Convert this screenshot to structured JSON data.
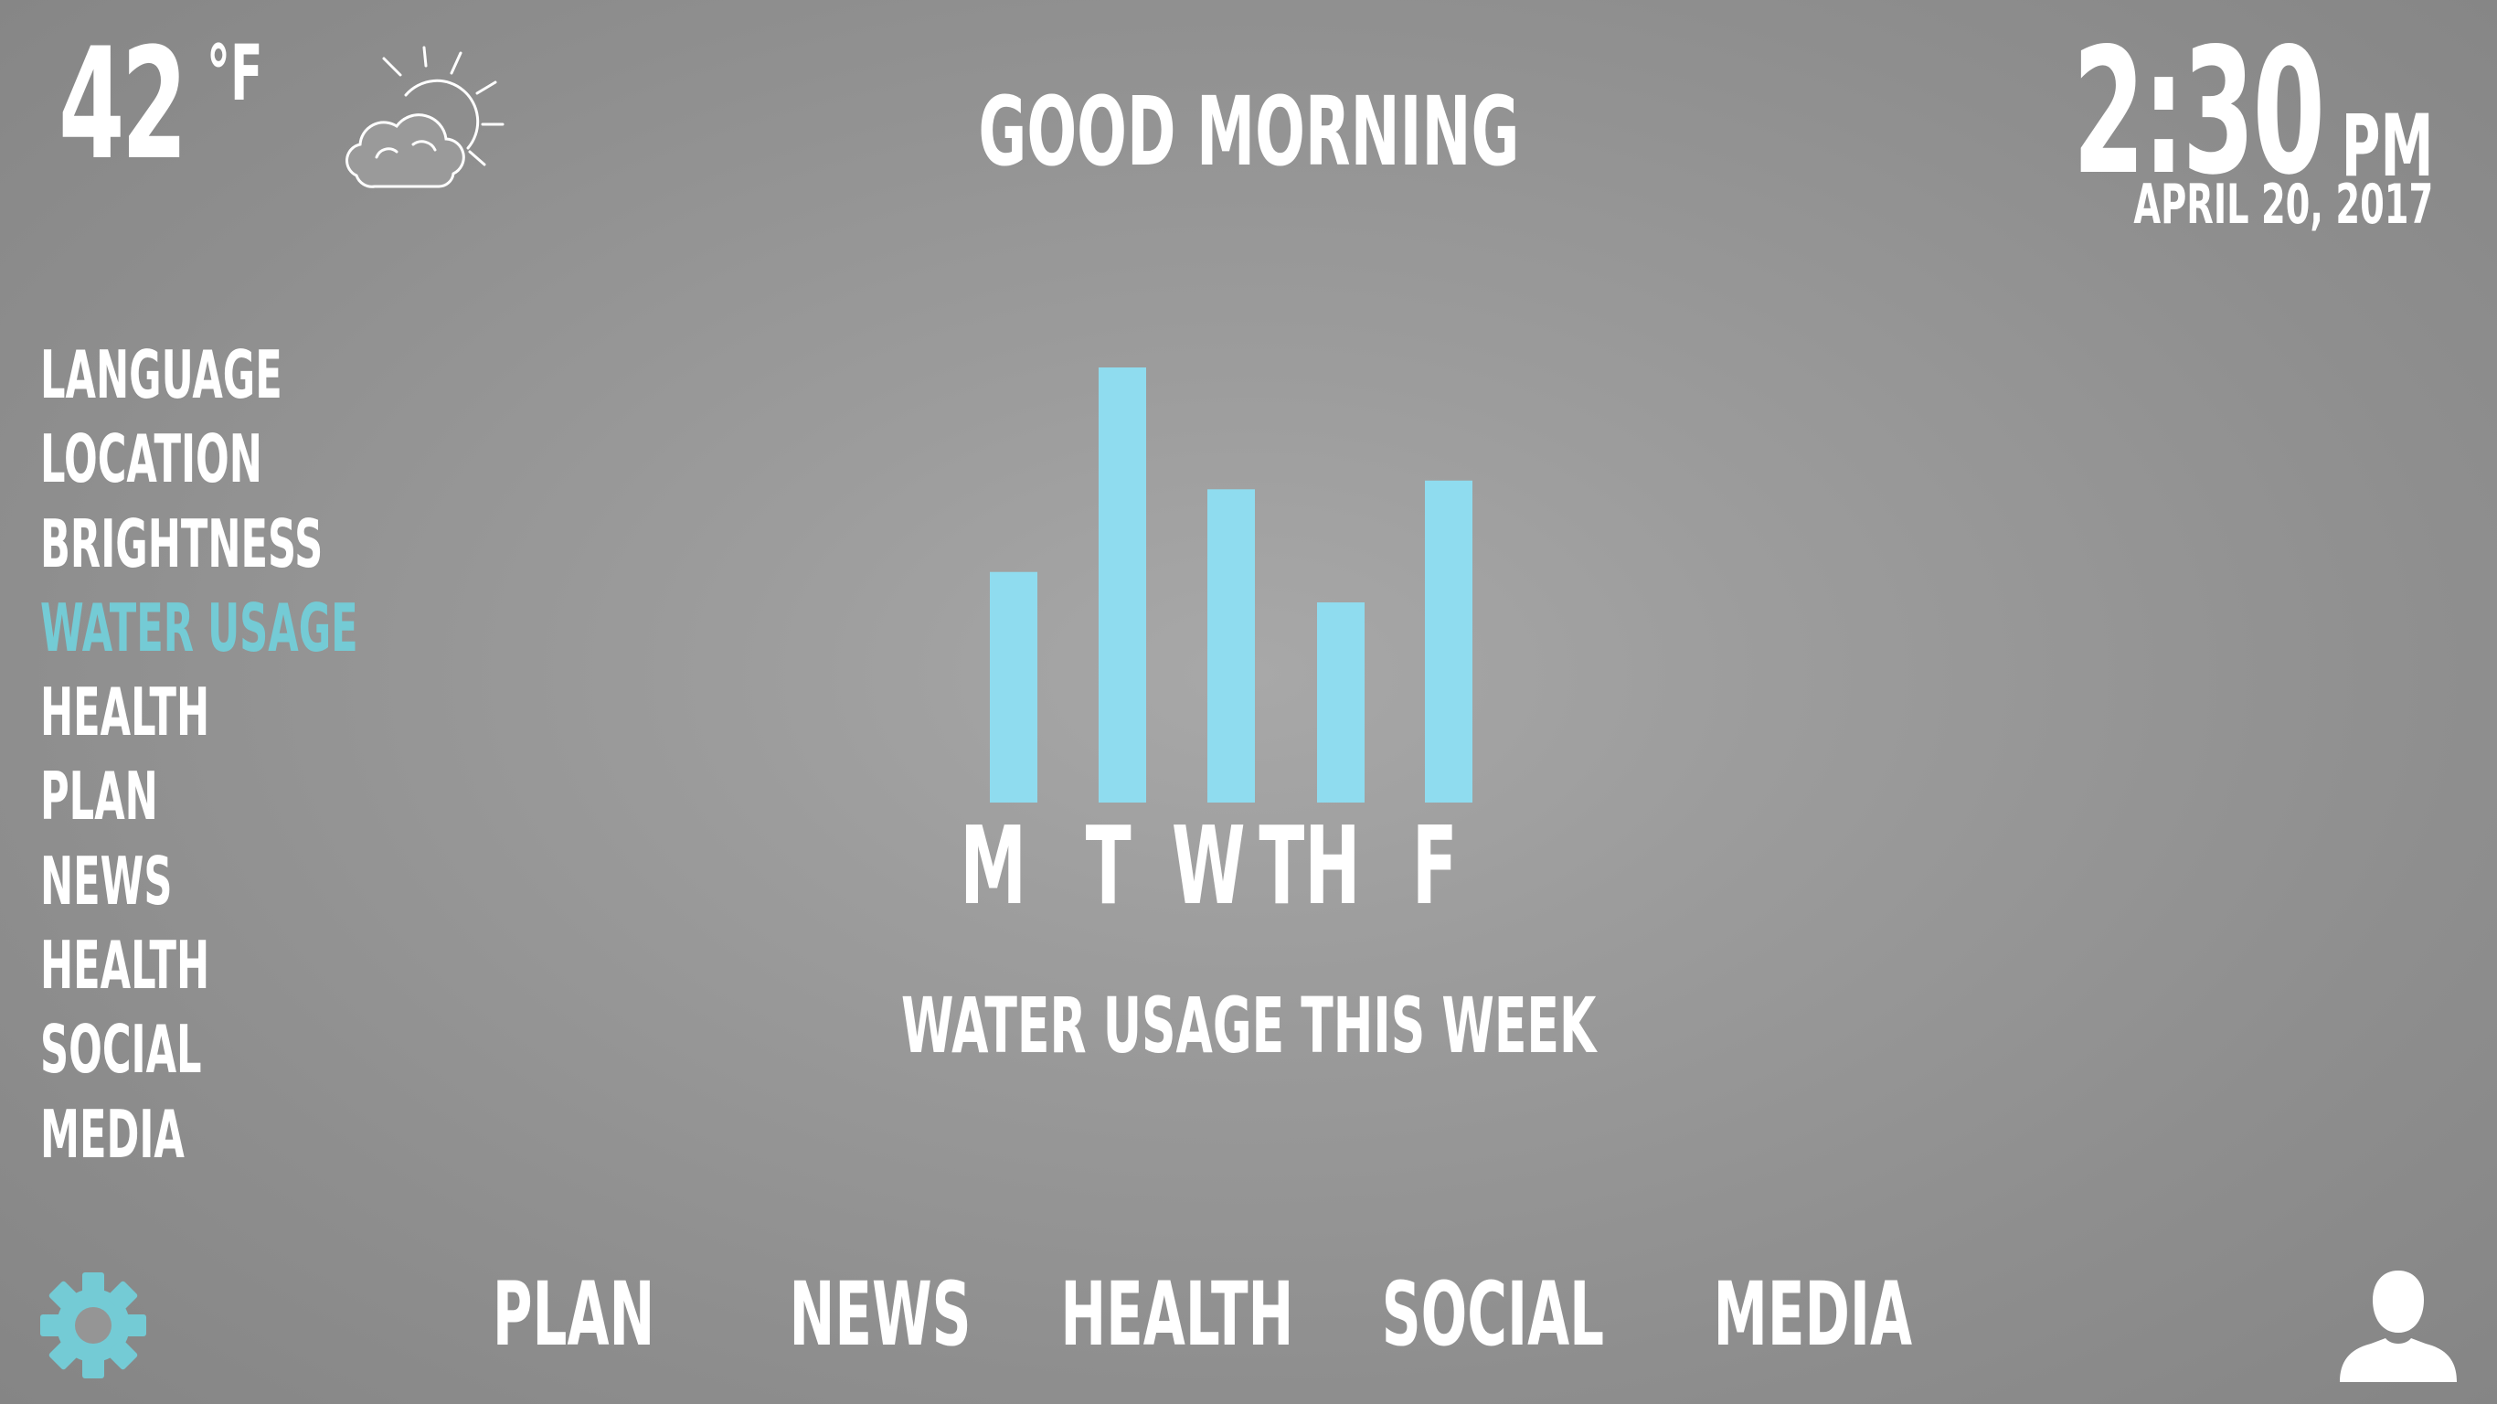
{
  "weather": {
    "temperature": "42",
    "unit": "°F",
    "condition_icon": "partly-sunny-cloud-icon"
  },
  "greeting": "GOOD MORNING",
  "clock": {
    "time": "2:30",
    "ampm": "PM",
    "date": "APRIL 20, 2017"
  },
  "sidebar": {
    "items": [
      {
        "label": "LANGUAGE"
      },
      {
        "label": "LOCATION"
      },
      {
        "label": "BRIGHTNESS"
      },
      {
        "label": "WATER USAGE",
        "active": true
      },
      {
        "label": "HEALTH"
      },
      {
        "label": "PLAN"
      },
      {
        "label": "NEWS"
      },
      {
        "label": "HEALTH"
      },
      {
        "label": "SOCIAL"
      },
      {
        "label": "MEDIA"
      }
    ]
  },
  "chart_data": {
    "type": "bar",
    "categories": [
      "M",
      "T",
      "W",
      "TH",
      "F"
    ],
    "values": [
      0.53,
      1.0,
      0.72,
      0.46,
      0.74
    ],
    "title": "WATER USAGE THIS WEEK",
    "ylim": [
      0,
      1
    ],
    "grid": false,
    "bar_color": "#8fdcef"
  },
  "bottom_nav": {
    "items": [
      {
        "label": "PLAN"
      },
      {
        "label": "NEWS"
      },
      {
        "label": "HEALTH"
      },
      {
        "label": "SOCIAL"
      },
      {
        "label": "MEDIA"
      }
    ]
  },
  "colors": {
    "accent": "#74cbd5",
    "text": "#ffffff",
    "bar": "#8fdcef"
  },
  "icons": {
    "settings": "gear-icon",
    "profile": "user-icon"
  }
}
